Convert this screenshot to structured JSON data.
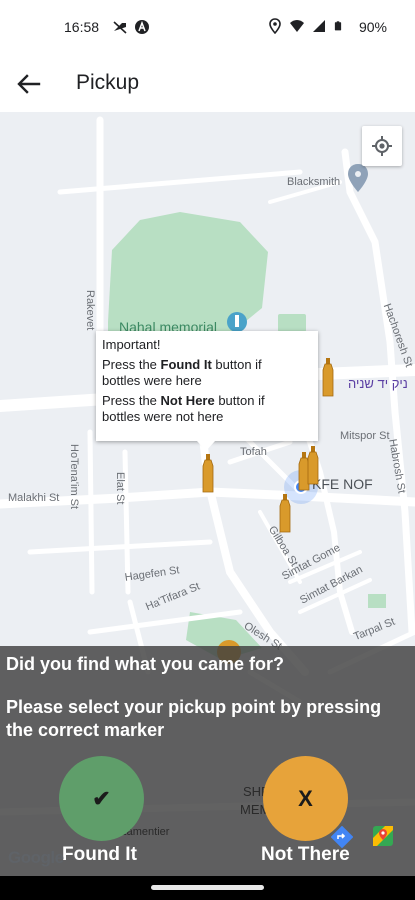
{
  "status_bar": {
    "time": "16:58",
    "battery": "90%",
    "icons": [
      "no-signal-icon",
      "a-icon",
      "location-pin-icon",
      "wifi-icon",
      "signal-icon",
      "battery-icon"
    ]
  },
  "app_bar": {
    "back_icon": "arrow-back-icon",
    "title": "Pickup"
  },
  "map": {
    "labels": {
      "blacksmith": "Blacksmith",
      "nahal_memorial": "Nahal memorial",
      "hebrew_street": "ניק יד שניה",
      "mitspor": "Mitspor St",
      "kfar_nof": "KFE NOF",
      "malakhi": "Malakhi St",
      "hotena": "HoTena'im St",
      "elat": "Elat St",
      "rakevet": "Rakevet",
      "tofah": "Tofah",
      "gilboa": "Gilboa St",
      "simtat_gome": "Simtat Gome",
      "simtat_barkan": "Simtat Barkan",
      "hagefen": "Hagefen St",
      "tifara": "Ha'Tifara St",
      "olesh": "Olesh St",
      "tarpal": "Tarpal St",
      "hachoresh": "Hachoresh St",
      "habrosh": "Habrosh St",
      "shrun": "SHRUN",
      "memorial": "MEMORIAL",
      "lamentier": "Derech Lamentier"
    },
    "popup": {
      "heading": "Important!",
      "line1_prefix": "Press the ",
      "line1_bold": "Found It",
      "line1_suffix": " button if",
      "line2": "bottles were here",
      "line3_prefix": "Press the ",
      "line3_bold": "Not Here",
      "line3_suffix": " button if",
      "line4": "bottles were not here"
    },
    "attribution": "Google"
  },
  "overlay": {
    "question": "Did you find what you came for?",
    "instruction": "Please select your pickup point by pressing the correct marker",
    "found_glyph": "✔",
    "found_label": "Found It",
    "not_there_glyph": "X",
    "not_there_label": "Not There"
  },
  "colors": {
    "found_button": "#5f9e6a",
    "not_there_button": "#e7a33a",
    "bottle": "#d99a2b",
    "overlay": "#404040",
    "map_park": "#b8dfc3",
    "map_background": "#eceff3"
  }
}
